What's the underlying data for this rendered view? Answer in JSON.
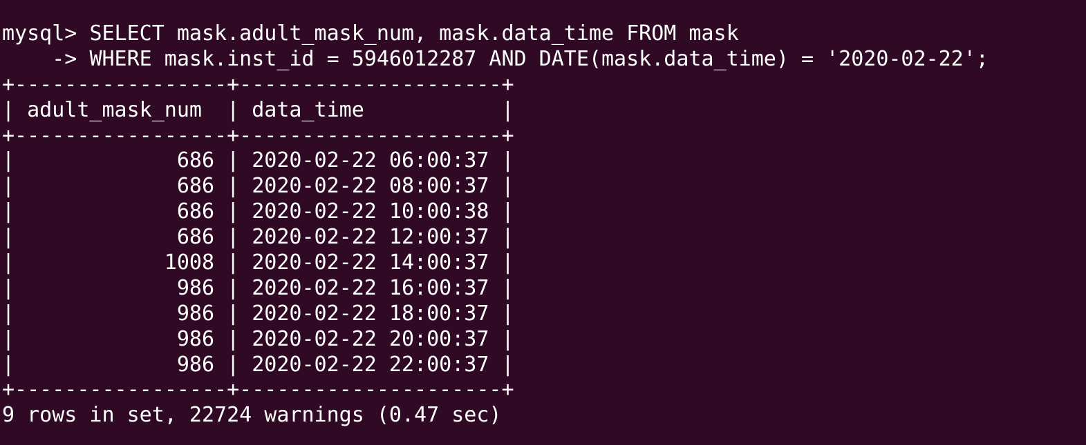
{
  "terminal": {
    "prompt": "mysql> ",
    "query_line_1": "SELECT mask.adult_mask_num, mask.data_time FROM mask",
    "continuation_prompt": "    -> ",
    "query_line_2": "WHERE mask.inst_id = 5946012287 AND DATE(mask.data_time) = '2020-02-22';",
    "border_line": "+-----------------+---------------------+",
    "header_line": "| adult_mask_num  | data_time           |",
    "rows": [
      "|             686 | 2020-02-22 06:00:37 |",
      "|             686 | 2020-02-22 08:00:37 |",
      "|             686 | 2020-02-22 10:00:38 |",
      "|             686 | 2020-02-22 12:00:37 |",
      "|            1008 | 2020-02-22 14:00:37 |",
      "|             986 | 2020-02-22 16:00:37 |",
      "|             986 | 2020-02-22 18:00:37 |",
      "|             986 | 2020-02-22 20:00:37 |",
      "|             986 | 2020-02-22 22:00:37 |"
    ],
    "result_summary": "9 rows in set, 22724 warnings (0.47 sec)"
  },
  "colors": {
    "background": "#300a24",
    "foreground": "#ffffff"
  }
}
